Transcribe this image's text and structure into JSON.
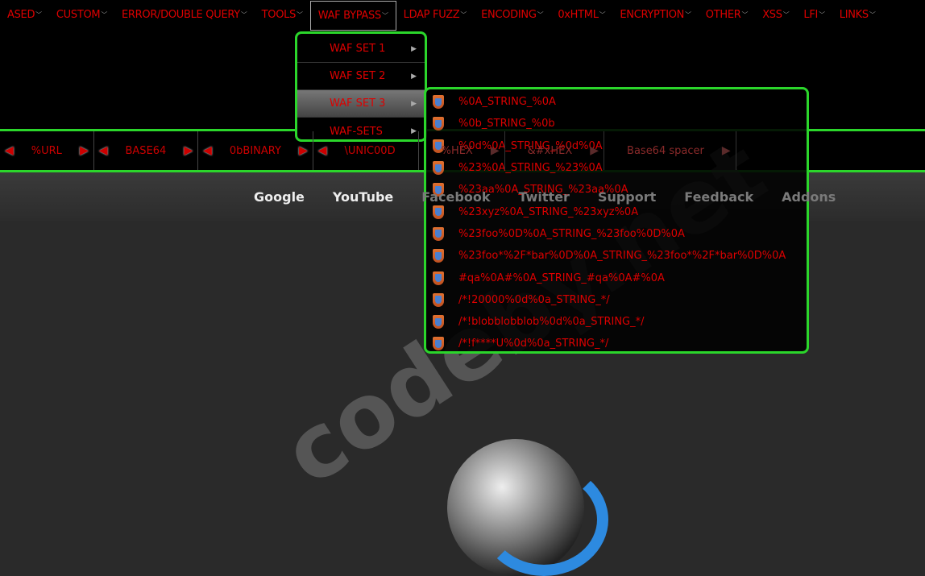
{
  "menubar": {
    "items": [
      "ASED",
      "CUSTOM",
      "ERROR/DOUBLE QUERY",
      "TOOLS",
      "WAF BYPASS",
      "LDAP FUZZ",
      "ENCODING",
      "0xHTML",
      "ENCRYPTION",
      "OTHER",
      "XSS",
      "LFI",
      "LINKS"
    ],
    "active": "WAF BYPASS"
  },
  "toolbar": {
    "items": [
      "%URL",
      "BASE64",
      "0bBINARY",
      "\\UNIC00D",
      "%HEX",
      "&#xHEX",
      "Base64 spacer"
    ]
  },
  "links": [
    "Google",
    "YouTube",
    "Facebook",
    "Twitter",
    "Support",
    "Feedback",
    "Addons"
  ],
  "waf_menu": {
    "items": [
      "WAF SET 1",
      "WAF SET 2",
      "WAF SET 3",
      "WAF-SETS"
    ],
    "highlighted": "WAF SET 3"
  },
  "waf_set3": {
    "items": [
      "%0A_STRING_%0A",
      "%0b_STRING_%0b",
      "%0d%0A_STRING_%0d%0A",
      "%23%0A_STRING_%23%0A",
      "%23aa%0A_STRING_%23aa%0A",
      "%23xyz%0A_STRING_%23xyz%0A",
      "%23foo%0D%0A_STRING_%23foo%0D%0A",
      "%23foo*%2F*bar%0D%0A_STRING_%23foo*%2F*bar%0D%0A",
      "#qa%0A#%0A_STRING_#qa%0A#%0A",
      "/*!20000%0d%0a_STRING_*/",
      "/*!blobblobblob%0d%0a_STRING_*/",
      "/*!f****U%0d%0a_STRING_*/"
    ]
  },
  "watermark": "codeby.net",
  "colors": {
    "accent": "#2bd62b",
    "text": "#dd0000"
  }
}
